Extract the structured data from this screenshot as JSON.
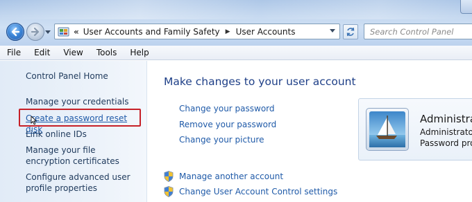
{
  "address": {
    "crumbs": [
      "User Accounts and Family Safety",
      "User Accounts"
    ],
    "search_placeholder": "Search Control Panel"
  },
  "menu": [
    "File",
    "Edit",
    "View",
    "Tools",
    "Help"
  ],
  "left_nav": {
    "home": "Control Panel Home",
    "items": [
      "Manage your credentials",
      "Create a password reset disk",
      "Link online IDs",
      "Manage your file encryption certificates",
      "Configure advanced user profile properties"
    ],
    "highlighted_item": "Create a password reset disk"
  },
  "main": {
    "heading": "Make changes to your user account",
    "links": [
      "Change your password",
      "Remove your password",
      "Change your picture"
    ],
    "shield_links": [
      "Manage another account",
      "Change User Account Control settings"
    ]
  },
  "user": {
    "name": "Administra",
    "role": "Administrator",
    "password_status": "Password prot"
  },
  "icons": {
    "back": "back-arrow-icon",
    "forward": "forward-arrow-icon",
    "control_panel": "control-panel-icon",
    "refresh": "refresh-icon",
    "shield": "uac-shield-icon",
    "cursor": "mouse-cursor-icon"
  },
  "colors": {
    "link": "#1f5aa8",
    "heading": "#1e3f87",
    "highlight_box": "#c62027"
  }
}
